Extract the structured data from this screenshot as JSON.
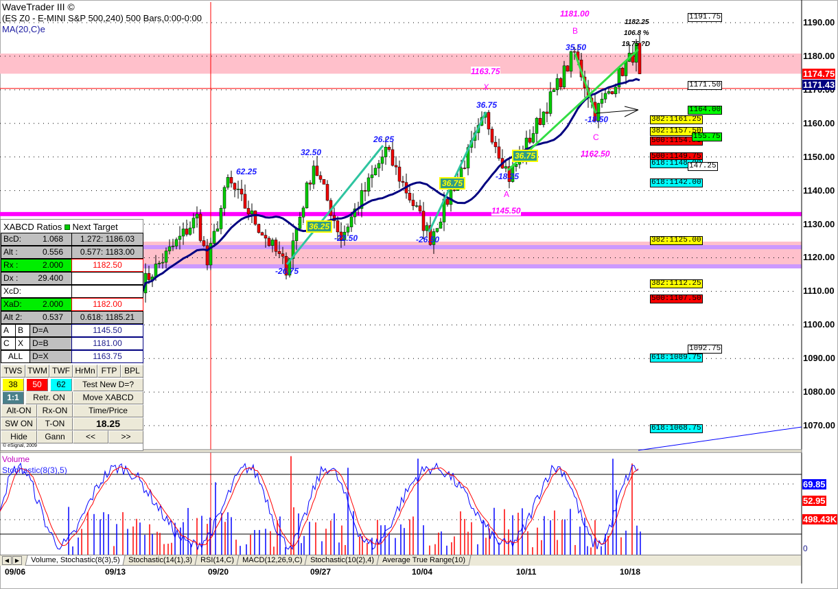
{
  "header": {
    "app_title": "WaveTrader III ©",
    "symbol_line": "(ES Z0 - E-MINI S&P 500,240) 500 Bars,0:00-0:00",
    "ma_label": "MA(20,C)e"
  },
  "price_axis": [
    "1190.00",
    "1180.00",
    "1170.00",
    "1160.00",
    "1150.00",
    "1140.00",
    "1130.00",
    "1120.00",
    "1110.00",
    "1100.00",
    "1090.00",
    "1080.00",
    "1070.00"
  ],
  "price_tags": {
    "last": "1174.75",
    "ma": "1171.43",
    "last_color": "#ff0000",
    "ma_color": "#000080"
  },
  "wave_labels": {
    "w62": "62.25",
    "m26_75": "-26.75",
    "w32_50": "32.50",
    "m22_50": "-22.50",
    "w26_25": "26.25",
    "m26_50": "-26.50",
    "w36_75": "36.75",
    "m18_25": "-18.25",
    "a": "A",
    "a_price": "1145.50",
    "x_price": "1163.75",
    "x": "X",
    "b_price": "1181.00",
    "b": "B",
    "w35_50": "35.50",
    "m18_50": "-18.50",
    "c": "C",
    "c_price": "1162.50",
    "d_price": "1182.25",
    "d_pct": "106.8 %",
    "d_pts": "19.75 ?D"
  },
  "badges": [
    "36.25",
    "36.75",
    "36.75"
  ],
  "level_tags": [
    {
      "text": "1191.75",
      "color": "#ffffff"
    },
    {
      "text": "1171.50",
      "color": "#ffffff"
    },
    {
      "text": "1164.00",
      "color": "#00ff00"
    },
    {
      "text": "382:1161.25",
      "color": "#ffff00"
    },
    {
      "text": "382:1157.50",
      "color": "#ffff00"
    },
    {
      "text": "500:1154.75",
      "color": "#ff0000"
    },
    {
      "text": "155.75",
      "color": "#00ff00"
    },
    {
      "text": "500:1149.75",
      "color": "#ff0000"
    },
    {
      "text": "618:1148.00",
      "color": "#00ffff"
    },
    {
      "text": "147.25",
      "color": "#ffffff"
    },
    {
      "text": "618:1142.00",
      "color": "#00ffff"
    },
    {
      "text": "382:1125.00",
      "color": "#ffff00"
    },
    {
      "text": "382:1112.25",
      "color": "#ffff00"
    },
    {
      "text": "500:1107.50",
      "color": "#ff0000"
    },
    {
      "text": "1092.75",
      "color": "#ffffff"
    },
    {
      "text": "618:1089.75",
      "color": "#00ffff"
    },
    {
      "text": "618:1068.75",
      "color": "#00ffff"
    }
  ],
  "xabcd": {
    "title": "XABCD Ratios",
    "next_target": "Next Target",
    "rows": [
      {
        "k": "BcD:",
        "v": "1.068",
        "t": "1.272: 1186.03"
      },
      {
        "k": "Alt  :",
        "v": "0.556",
        "t": "0.577: 1183.00"
      },
      {
        "k": "Rx   :",
        "v": "2.000",
        "t": "1182.50"
      },
      {
        "k": "Dx   :",
        "v": "29.400",
        "t": ""
      },
      {
        "k": "XcD:",
        "v": "",
        "t": ""
      },
      {
        "k": "XaD:",
        "v": "2.000",
        "t": "1182.00"
      },
      {
        "k": "Alt 2:",
        "v": "0.537",
        "t": "0.618: 1185.21"
      }
    ],
    "points": [
      {
        "a": "A",
        "b": "B",
        "d": "D=A",
        "v": "1145.50"
      },
      {
        "a": "C",
        "b": "X",
        "d": "D=B",
        "v": "1181.00"
      },
      {
        "a": "ALL",
        "b": "",
        "d": "D=X",
        "v": "1163.75"
      }
    ],
    "buttons": {
      "tws": "TWS",
      "twm": "TWM",
      "twf": "TWF",
      "hrmn": "HrMn",
      "ftp": "FTP",
      "bpl": "BPL",
      "v38": "38",
      "v50": "50",
      "v62": "62",
      "test": "Test New D=?",
      "ratio": "1:1",
      "retr": "Retr. ON",
      "move": "Move XABCD",
      "alt": "Alt-ON",
      "rx": "Rx-ON",
      "timeprice": "Time/Price",
      "sw": "SW ON",
      "t": "T-ON",
      "value": "18.25",
      "hide": "Hide",
      "gann": "Gann",
      "prev": "<<",
      "next": ">>"
    },
    "copyright": "© eSignal, 2009"
  },
  "lower": {
    "volume_label": "Volume",
    "stoch_label": "Stochastic(8(3),5)",
    "k_value": "69.85",
    "d_value": "52.95",
    "vol_value": "498.43K",
    "zero": "0"
  },
  "tabs": [
    "Volume, Stochastic(8(3),5)",
    "Stochastic(14(1),3)",
    "RSI(14,C)",
    "MACD(12,26,9,C)",
    "Stochastic(10(2),4)",
    "Average True Range(10)"
  ],
  "dates": [
    "09/06",
    "09/13",
    "09/20",
    "09/27",
    "10/04",
    "10/11",
    "10/18"
  ],
  "chart_data": {
    "type": "candlestick",
    "title": "ES Z0 - E-MINI S&P 500, 240 min",
    "ylim": [
      1062,
      1195
    ],
    "swings": [
      [
        0,
        1112
      ],
      [
        16,
        1132
      ],
      [
        19,
        1118
      ],
      [
        25,
        1143
      ],
      [
        42,
        1117
      ],
      [
        50,
        1148
      ],
      [
        58,
        1126
      ],
      [
        71,
        1152
      ],
      [
        84,
        1126
      ],
      [
        100,
        1162
      ],
      [
        107,
        1144
      ],
      [
        126,
        1181
      ],
      [
        132,
        1163
      ],
      [
        140,
        1176
      ],
      [
        144,
        1182
      ],
      [
        145,
        1174.75
      ]
    ],
    "ma_period": 20,
    "bands": {
      "upper_zone": [
        1174.8,
        1180.8
      ],
      "lower_zone": [
        1118,
        1124.8
      ],
      "magenta_level": 1133,
      "red_level": 1170.4
    }
  }
}
